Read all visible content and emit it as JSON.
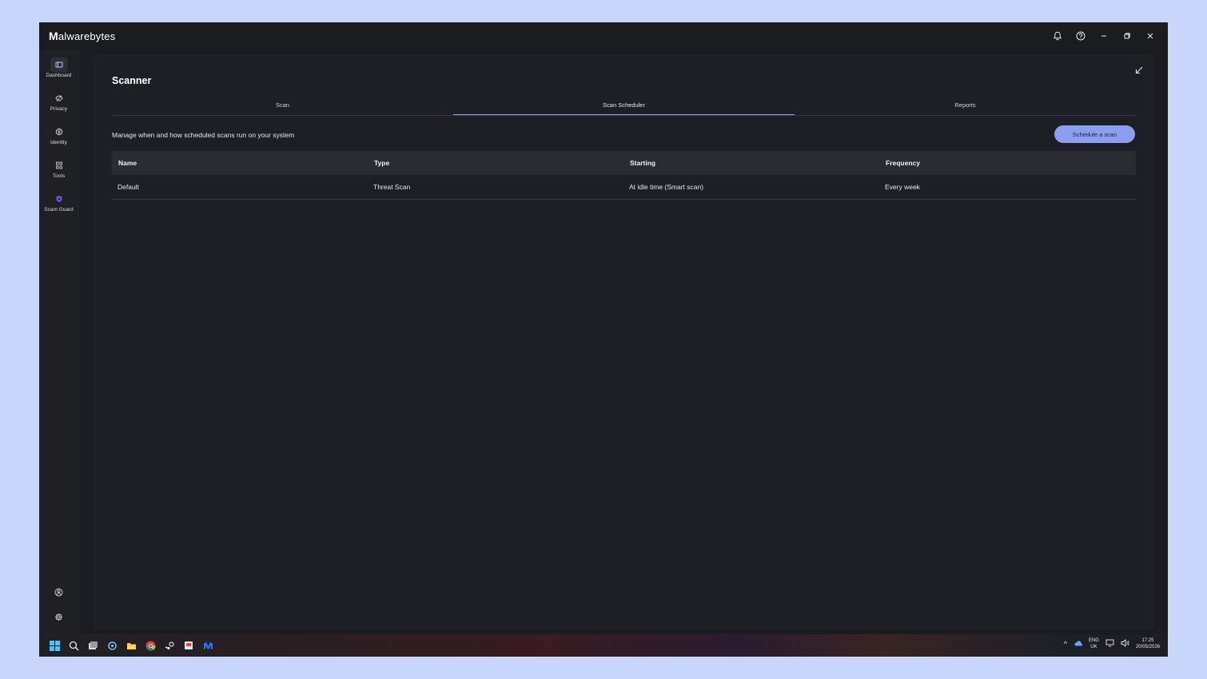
{
  "app": {
    "logo_m": "M",
    "logo_rest": "alwarebytes"
  },
  "titlebar": {
    "icons": [
      "bell-icon",
      "help-icon",
      "minimize-icon",
      "restore-icon",
      "close-icon"
    ]
  },
  "sidebar": {
    "items": [
      {
        "label": "Dashboard",
        "icon": "dashboard-icon"
      },
      {
        "label": "Privacy",
        "icon": "privacy-eye-icon"
      },
      {
        "label": "Identity",
        "icon": "identity-icon"
      },
      {
        "label": "Tools",
        "icon": "tools-icon"
      },
      {
        "label": "Scam Guard",
        "icon": "scam-guard-icon"
      }
    ],
    "bottom_icons": [
      "account-icon",
      "settings-gear-icon"
    ]
  },
  "page": {
    "title": "Scanner",
    "tabs": [
      {
        "label": "Scan",
        "active": false
      },
      {
        "label": "Scan Scheduler",
        "active": true
      },
      {
        "label": "Reports",
        "active": false
      }
    ],
    "description": "Manage when and how scheduled scans run on your system",
    "schedule_button": "Schedule a scan"
  },
  "table": {
    "headers": [
      "Name",
      "Type",
      "Starting",
      "Frequency"
    ],
    "rows": [
      [
        "Default",
        "Threat Scan",
        "At idle time (Smart scan)",
        "Every week"
      ]
    ]
  },
  "taskbar": {
    "lang_top": "ENG",
    "lang_bottom": "UK",
    "time": "17:25",
    "date": "20/05/2026"
  },
  "colors": {
    "accent": "#8c9ef0",
    "background": "#1b1c20",
    "desktop": "#c8d6fb"
  }
}
